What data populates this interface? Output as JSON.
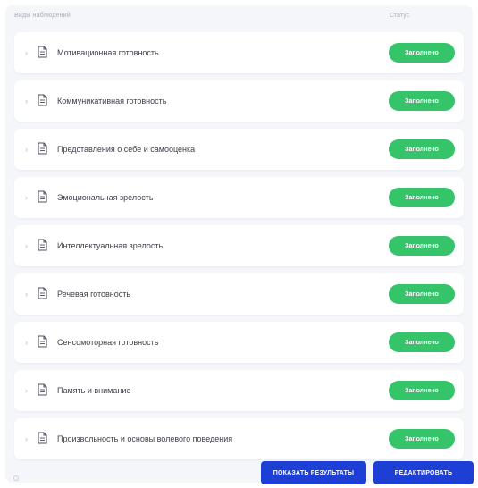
{
  "header": {
    "col_name": "Виды наблюдений",
    "col_status": "Статус"
  },
  "rows": [
    {
      "title": "Мотивационная готовность",
      "status": "Заполнено"
    },
    {
      "title": "Коммуникативная готовность",
      "status": "Заполнено"
    },
    {
      "title": "Представления о себе и самооценка",
      "status": "Заполнено"
    },
    {
      "title": "Эмоциональная зрелость",
      "status": "Заполнено"
    },
    {
      "title": "Интеллектуальная зрелость",
      "status": "Заполнено"
    },
    {
      "title": "Речевая готовность",
      "status": "Заполнено"
    },
    {
      "title": "Сенсомоторная готовность",
      "status": "Заполнено"
    },
    {
      "title": "Память и внимание",
      "status": "Заполнено"
    },
    {
      "title": "Произвольность и основы волевого поведения",
      "status": "Заполнено"
    }
  ],
  "actions": {
    "show_results": "ПОКАЗАТЬ РЕЗУЛЬТАТЫ",
    "edit": "РЕДАКТИРОВАТЬ"
  },
  "colors": {
    "status_green": "#35c46a",
    "primary_blue": "#1d3fd6",
    "panel_bg": "#f4f6fa"
  },
  "icons": {
    "expand": "chevron-right-icon",
    "document": "document-icon"
  }
}
